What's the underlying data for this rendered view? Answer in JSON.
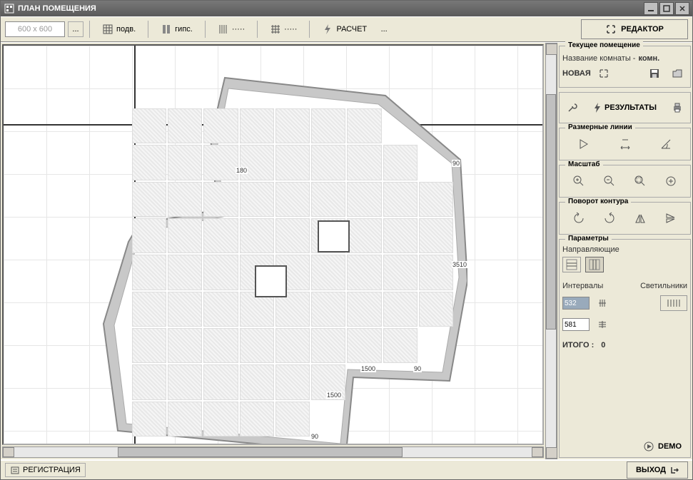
{
  "title": "ПЛАН ПОМЕЩЕНИЯ",
  "toolbar": {
    "size_input": "600 x 600",
    "ceiling_label": "подв.",
    "gips_label": "гипс.",
    "hatch1": "·····",
    "hatch2": "·····",
    "calc_label": "РАСЧЕТ",
    "editor_label": "РЕДАКТОР",
    "dots": "..."
  },
  "side": {
    "current_room_title": "Текущее помещение",
    "room_name_label": "Название комнаты -",
    "room_name_value": "комн.",
    "new_label": "НОВАЯ",
    "results_label": "РЕЗУЛЬТАТЫ",
    "dim_lines_title": "Размерные линии",
    "scale_title": "Масштаб",
    "rotate_title": "Поворот контура",
    "params_title": "Параметры",
    "guides_label": "Направляющие",
    "intervals_label": "Интервалы",
    "lights_label": "Светильники",
    "interval_x": "532",
    "interval_y": "581",
    "total_label": "ИТОГО :",
    "total_value": "0",
    "demo_label": "DEMO"
  },
  "status": {
    "reg_label": "РЕГИСТРАЦИЯ",
    "exit_label": "ВЫХОД"
  },
  "canvas": {
    "dims": {
      "d180": "180",
      "d90a": "90",
      "d3510": "3510",
      "d90b": "90",
      "d1500a": "1500",
      "d1500b": "1500",
      "d90c": "90"
    }
  }
}
